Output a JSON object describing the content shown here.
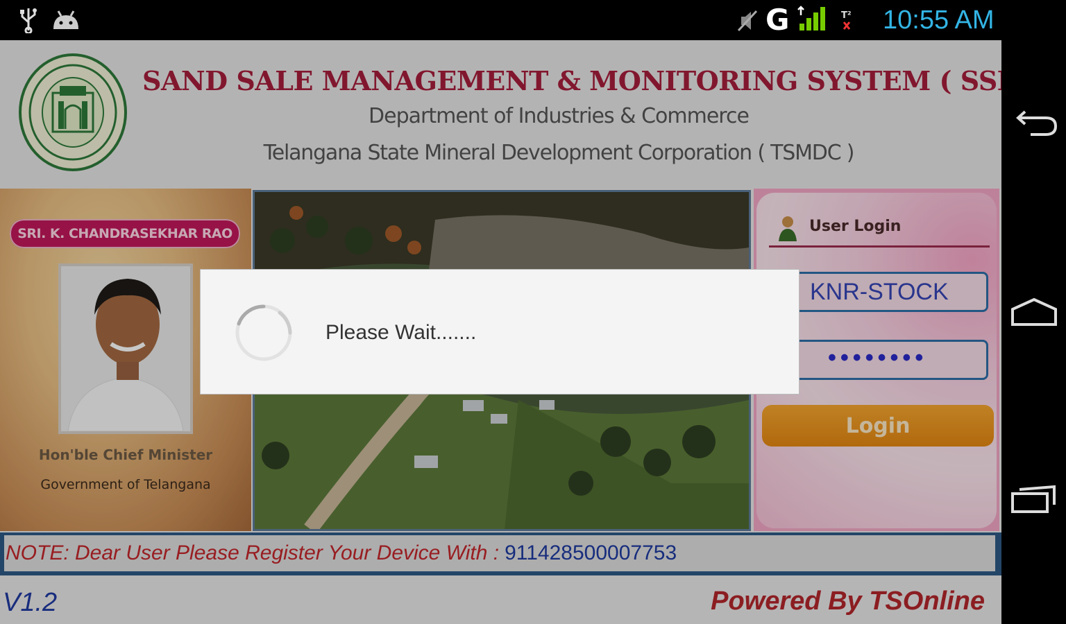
{
  "status_bar": {
    "time": "10:55 AM",
    "network": "G",
    "time_color": "#33b5e5",
    "icons": [
      "usb-icon",
      "android-debug-icon",
      "mute-icon",
      "signal-icon",
      "sim-2-icon"
    ]
  },
  "header": {
    "title": "SAND SALE MANAGEMENT & MONITORING SYSTEM ( SSMMS )",
    "subtitle_1": "Department of Industries & Commerce",
    "subtitle_2": "Telangana State Mineral Development Corporation ( TSMDC )",
    "title_color": "#a61e3c"
  },
  "leader_panel": {
    "name_badge": "SRI. K. CHANDRASEKHAR RAO",
    "designation": "Hon'ble Chief Minister",
    "government": "Government of Telangana"
  },
  "login": {
    "heading": "User Login",
    "username_value": "KNR-STOCK",
    "password_mask": "••••••••",
    "button_label": "Login",
    "button_color": "#e48712"
  },
  "note": {
    "text": "NOTE: Dear User Please Register Your Device With :",
    "device_number": "911428500007753"
  },
  "footer": {
    "version": "V1.2",
    "powered_by": "Powered By TSOnline"
  },
  "dialog": {
    "message": "Please Wait......."
  },
  "nav_bar": {
    "buttons": [
      "back-icon",
      "home-icon",
      "recent-apps-icon"
    ]
  }
}
